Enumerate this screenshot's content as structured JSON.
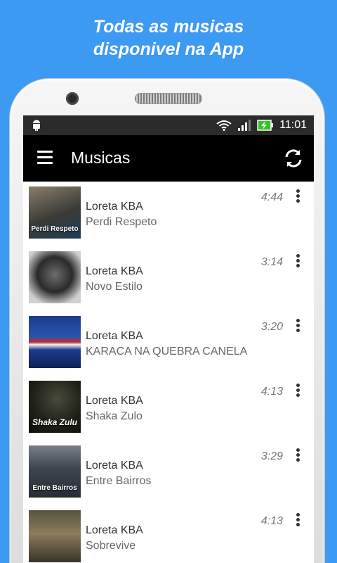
{
  "promo": {
    "line1": "Todas as musicas",
    "line2": "disponivel na App"
  },
  "status_bar": {
    "time": "11:01",
    "icons": [
      "android-icon",
      "wifi-icon",
      "signal-icon",
      "battery-charging-icon"
    ]
  },
  "toolbar": {
    "title": "Musicas",
    "menu_icon": "hamburger-menu-icon",
    "refresh_icon": "refresh-icon"
  },
  "colors": {
    "background": "#3d9af2",
    "toolbar": "#000000",
    "status_bar": "#2b2b2b",
    "battery": "#39c02c"
  },
  "songs": [
    {
      "artist": "Loreta KBA",
      "title": "Perdi Respeto",
      "duration": "4:44",
      "cover_text": "Perdi Respeto"
    },
    {
      "artist": "Loreta KBA",
      "title": "Novo Estilo",
      "duration": "3:14",
      "cover_text": ""
    },
    {
      "artist": "Loreta KBA",
      "title": "KARACA NA QUEBRA CANELA",
      "duration": "3:20",
      "cover_text": ""
    },
    {
      "artist": "Loreta KBA",
      "title": "Shaka Zulo",
      "duration": "4:13",
      "cover_text": "Shaka Zulu"
    },
    {
      "artist": "Loreta KBA",
      "title": "Entre Bairros",
      "duration": "3:29",
      "cover_text": "Entre Bairros"
    },
    {
      "artist": "Loreta KBA",
      "title": "Sobrevive",
      "duration": "4:13",
      "cover_text": ""
    }
  ]
}
